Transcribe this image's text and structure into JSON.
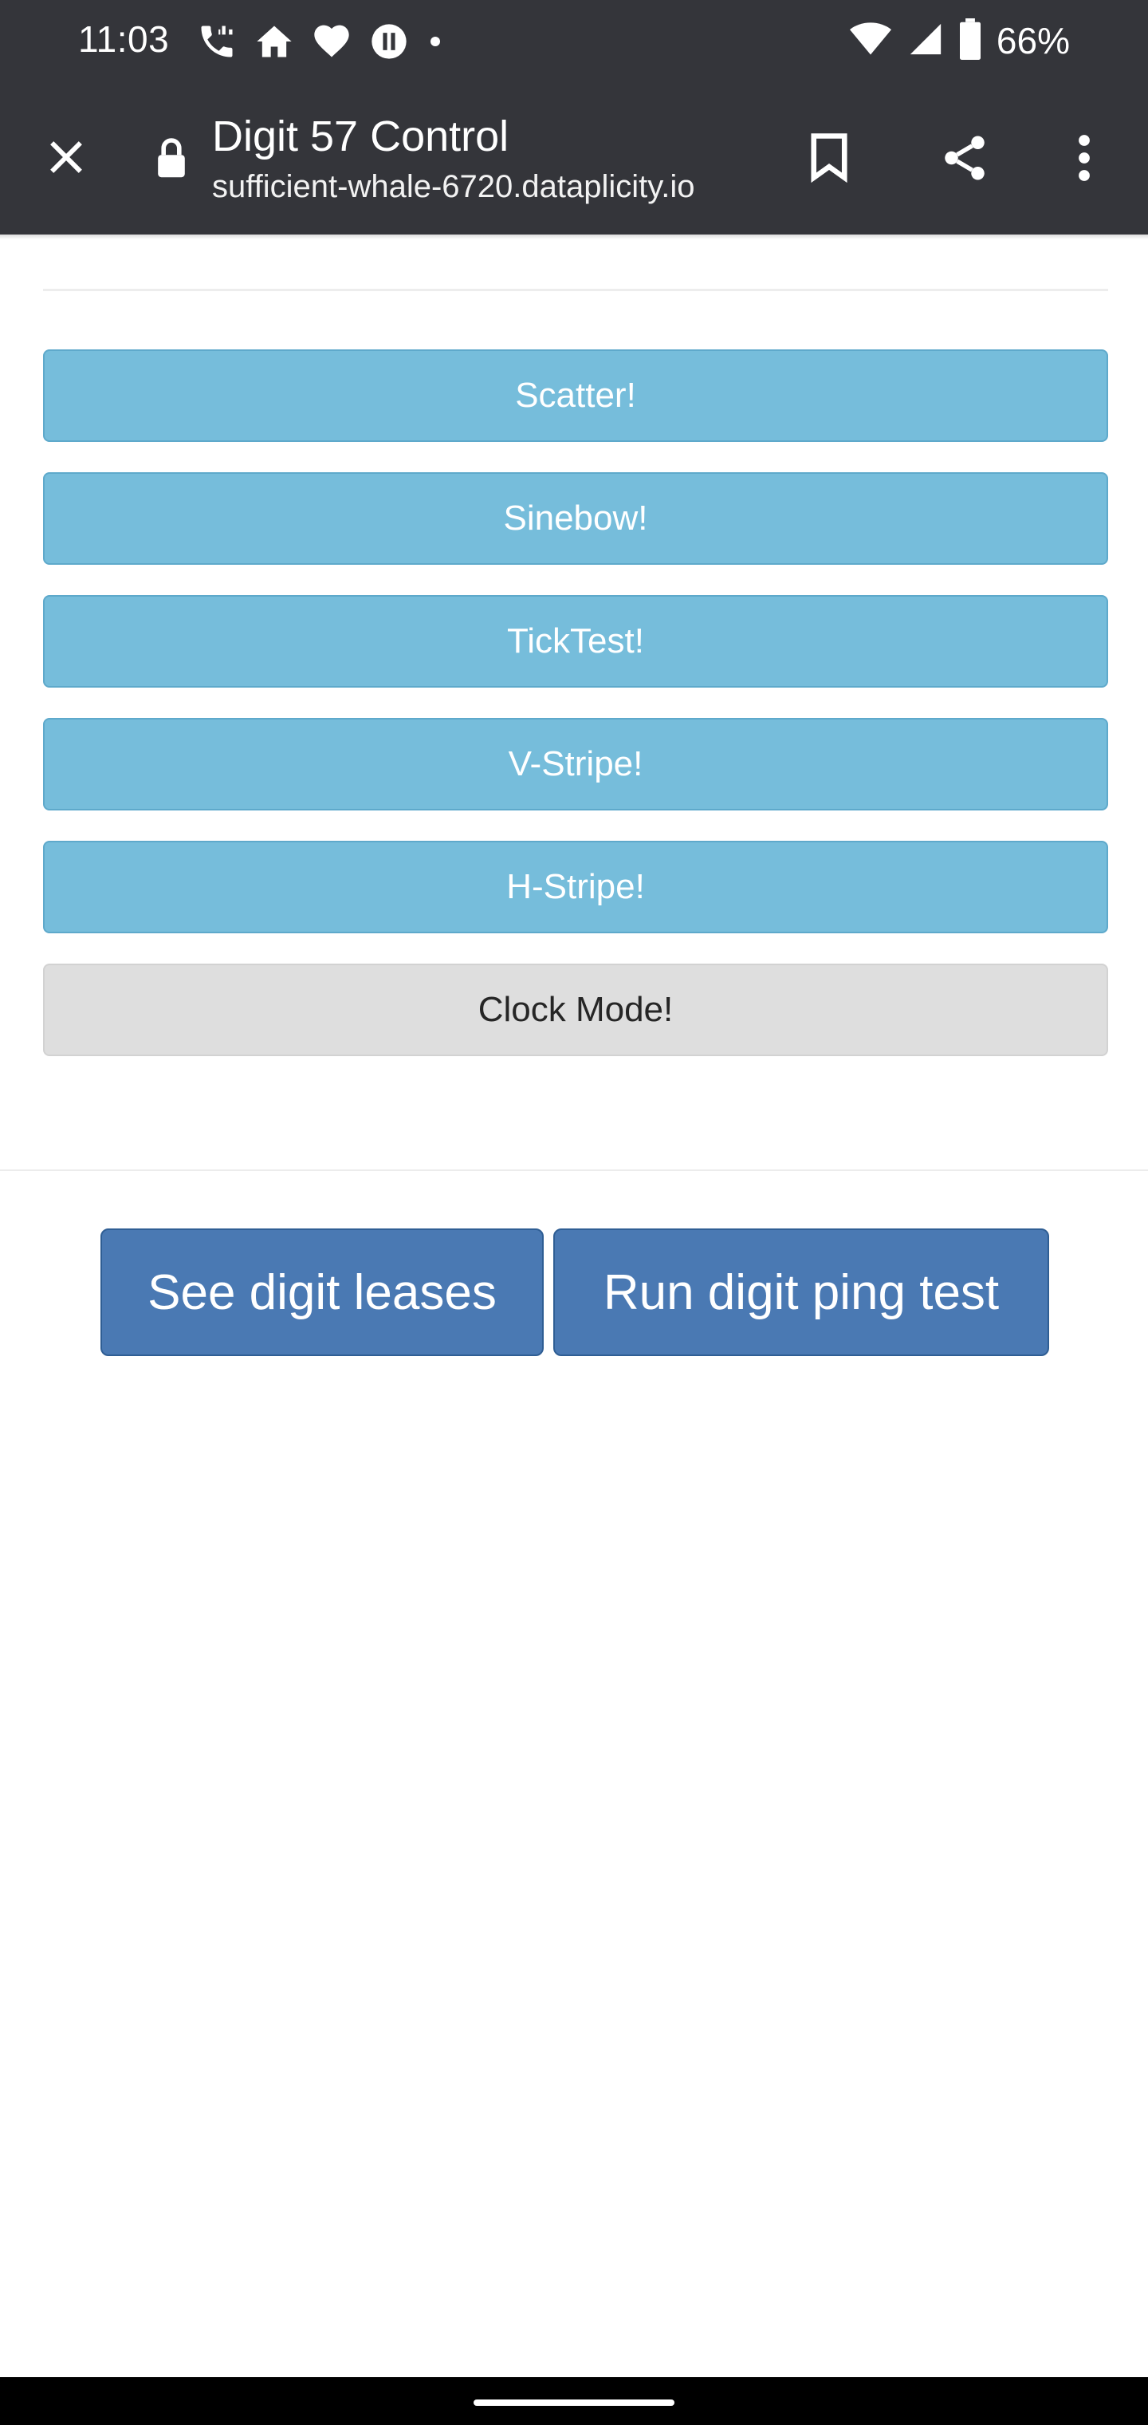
{
  "status_bar": {
    "time": "11:03",
    "left_icons": [
      "phone-call-icon",
      "home-icon",
      "heart-icon",
      "pause-icon",
      "dot-icon"
    ],
    "battery_percent": "66%",
    "right_icons": [
      "wifi-icon",
      "cellular-signal-icon",
      "battery-icon"
    ]
  },
  "toolbar": {
    "title": "Digit 57 Control",
    "url": "sufficient-whale-6720.dataplicity.io",
    "icons": [
      "close-icon",
      "lock-icon",
      "bookmark-icon",
      "share-icon",
      "more-vert-icon"
    ]
  },
  "pattern_buttons": [
    {
      "label": "Scatter!"
    },
    {
      "label": "Sinebow!"
    },
    {
      "label": "TickTest!"
    },
    {
      "label": "V-Stripe!"
    },
    {
      "label": "H-Stripe!"
    },
    {
      "label": "Clock Mode!"
    }
  ],
  "actions": {
    "leases_label": "See digit leases",
    "ping_label": "Run digit ping test"
  },
  "colors": {
    "chrome": "#34353a",
    "pattern_button": "#76bddb",
    "clock_button": "#dedede",
    "action_button": "#4a79b3"
  }
}
